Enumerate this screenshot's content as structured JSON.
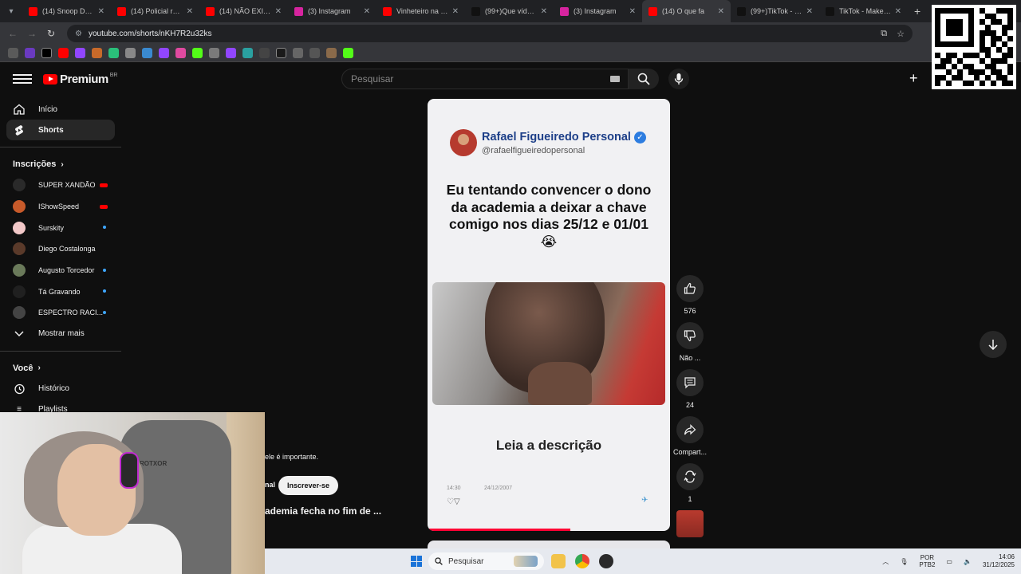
{
  "browser": {
    "tabs": [
      {
        "title": "(14) Snoop Dogg",
        "color": "#ff0000"
      },
      {
        "title": "(14) Policial recebe",
        "color": "#ff0000"
      },
      {
        "title": "(14) NÃO EXISTIR",
        "color": "#ff0000"
      },
      {
        "title": "(3) Instagram",
        "color": "#d6249f"
      },
      {
        "title": "Vinheteiro na tor",
        "color": "#ff0000"
      },
      {
        "title": "(99+)Que vídeo F",
        "color": "#111111"
      },
      {
        "title": "(3) Instagram",
        "color": "#d6249f"
      },
      {
        "title": "(14) O que fa",
        "color": "#ff0000",
        "active": true
      },
      {
        "title": "(99+)TikTok - Mak",
        "color": "#111111"
      },
      {
        "title": "TikTok - Make Yo",
        "color": "#111111"
      }
    ],
    "url": "youtube.com/shorts/nKH7R2u32ks"
  },
  "youtube": {
    "logo_text": "Premium",
    "country_code": "BR",
    "search_placeholder": "Pesquisar"
  },
  "sidebar": {
    "home": "Início",
    "shorts": "Shorts",
    "subscriptions_heading": "Inscrições",
    "subscriptions": [
      {
        "name": "SUPER XANDÃO",
        "color": "#2a2a2a",
        "status": "live"
      },
      {
        "name": "IShowSpeed",
        "color": "#c75a2a",
        "status": "live"
      },
      {
        "name": "Surskity",
        "color": "#f2c8c8",
        "status": "new"
      },
      {
        "name": "Diego Costalonga",
        "color": "#5a3a2a",
        "status": ""
      },
      {
        "name": "Augusto Torcedor",
        "color": "#6a7a5a",
        "status": "new"
      },
      {
        "name": "Tá Gravando",
        "color": "#202020",
        "status": "new"
      },
      {
        "name": "ESPECTRO RACI...",
        "color": "#444444",
        "status": "new"
      }
    ],
    "show_more": "Mostrar mais",
    "you_heading": "Você",
    "history": "Histórico",
    "playlists": "Playlists"
  },
  "short": {
    "author_name": "Rafael Figueiredo Personal",
    "author_handle": "@rafaelfigueiredopersonal",
    "caption": "Eu tentando convencer o dono da academia a deixar a chave comigo nos dias 25/12 e 01/01 😭",
    "read_description": "Leia a descrição",
    "post_time": "14:30",
    "post_date": "24/12/2007",
    "progress_fraction": 0.59
  },
  "actions": {
    "likes": "576",
    "dislike_label": "Não ...",
    "comments": "24",
    "share_label": "Compart...",
    "remix_count": "1"
  },
  "overlay": {
    "snippet_top": "ele é importante.",
    "channel_snippet": "nal",
    "subscribe_label": "Inscrever-se",
    "title_snippet": "ademia fecha no fim de ..."
  },
  "webcam": {
    "chair_brand": "ROTXOR"
  },
  "taskbar": {
    "search_placeholder": "Pesquisar",
    "lang_line1": "POR",
    "lang_line2": "PTB2",
    "time": "14:06",
    "date": "31/12/2025"
  }
}
